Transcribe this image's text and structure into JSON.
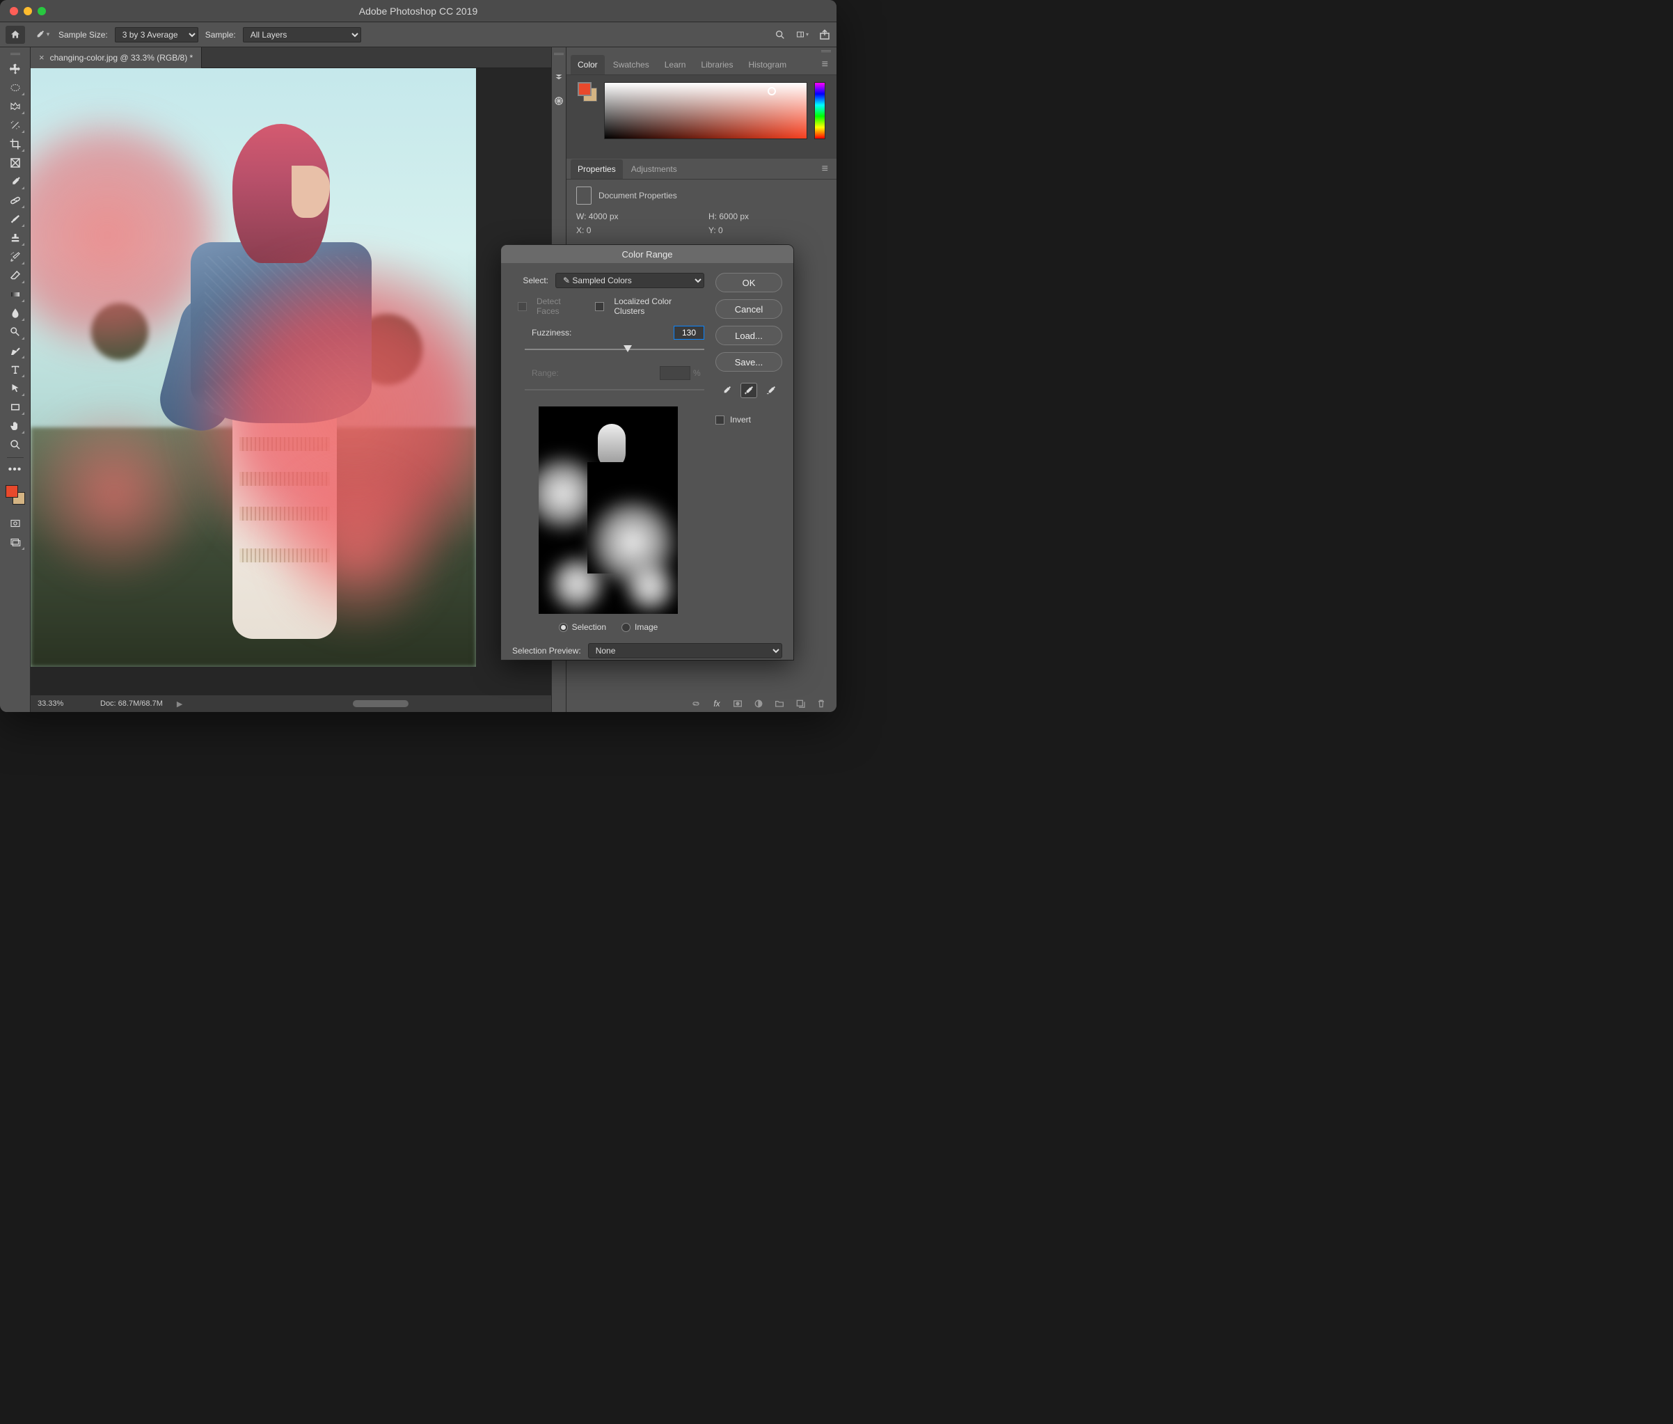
{
  "app_title": "Adobe Photoshop CC 2019",
  "optbar": {
    "sample_size_label": "Sample Size:",
    "sample_size_value": "3 by 3 Average",
    "sample_label": "Sample:",
    "sample_value": "All Layers"
  },
  "document": {
    "tab_title": "changing-color.jpg @ 33.3% (RGB/8) *",
    "zoom": "33.33%",
    "doc_info": "Doc: 68.7M/68.7M"
  },
  "panels": {
    "color_tabs": [
      "Color",
      "Swatches",
      "Learn",
      "Libraries",
      "Histogram"
    ],
    "props_tabs": [
      "Properties",
      "Adjustments"
    ],
    "doc_props_label": "Document Properties",
    "w_label": "W:",
    "w_value": "4000 px",
    "h_label": "H:",
    "h_value": "6000 px",
    "x_label": "X:",
    "x_value": "0",
    "y_label": "Y:",
    "y_value": "0"
  },
  "tools": [
    "move",
    "marquee",
    "lasso",
    "quick-select",
    "crop",
    "frame",
    "eyedropper",
    "spot-heal",
    "brush",
    "clone-stamp",
    "history-brush",
    "eraser",
    "gradient",
    "blur",
    "dodge",
    "pen",
    "type",
    "path-select",
    "rectangle",
    "hand",
    "zoom"
  ],
  "colors": {
    "fg": "#e8492c",
    "bg": "#d4b483"
  },
  "dialog": {
    "title": "Color Range",
    "select_label": "Select:",
    "select_value": "Sampled Colors",
    "detect_faces": "Detect Faces",
    "localized": "Localized Color Clusters",
    "fuzziness_label": "Fuzziness:",
    "fuzziness_value": "130",
    "range_label": "Range:",
    "range_pct": "%",
    "radio_selection": "Selection",
    "radio_image": "Image",
    "preview_label": "Selection Preview:",
    "preview_value": "None",
    "buttons": {
      "ok": "OK",
      "cancel": "Cancel",
      "load": "Load...",
      "save": "Save..."
    },
    "invert": "Invert"
  }
}
